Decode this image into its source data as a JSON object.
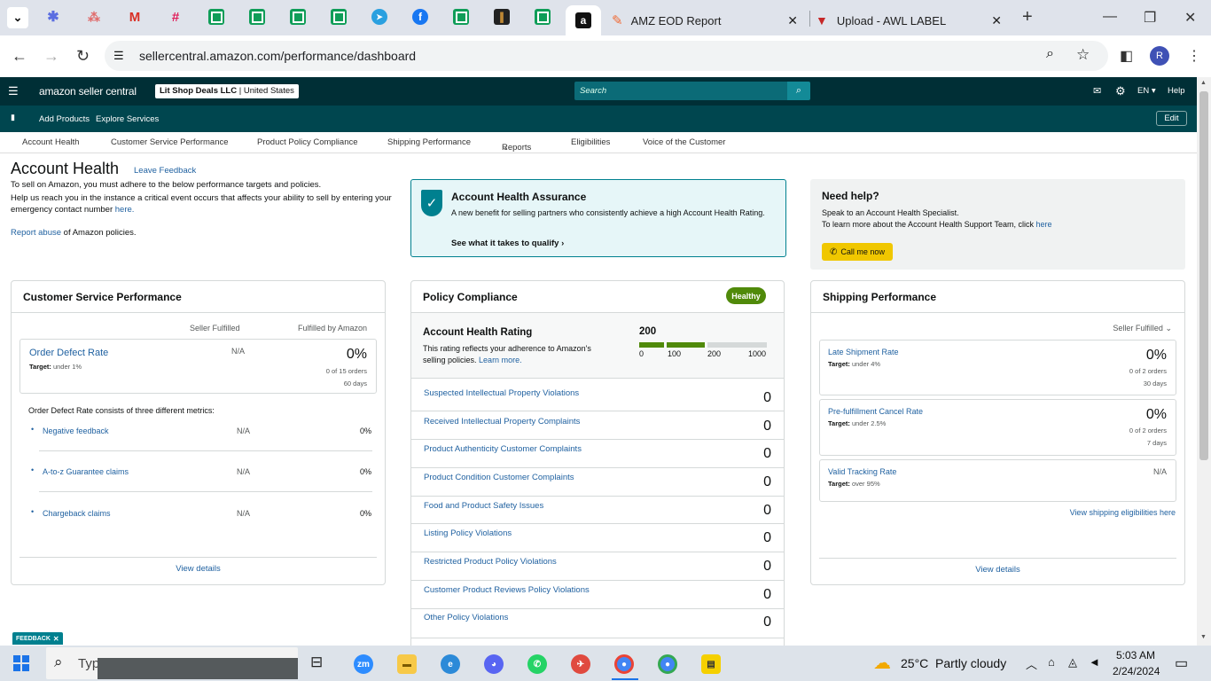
{
  "browser": {
    "active_tab_icon": "a",
    "tabs": [
      {
        "title": "AMZ EOD Report"
      },
      {
        "title": "Upload - AWL LABEL"
      }
    ],
    "url": "sellercentral.amazon.com/performance/dashboard",
    "profile_initial": "R"
  },
  "header": {
    "logo": "amazon seller central",
    "store_name": "Lit Shop Deals LLC",
    "store_region": "United States",
    "search_placeholder": "Search",
    "language": "EN",
    "help": "Help"
  },
  "subnav": {
    "items": [
      "Add Products",
      "Explore Services"
    ],
    "edit": "Edit"
  },
  "topnav": {
    "items": [
      "Account Health",
      "Customer Service Performance",
      "Product Policy Compliance",
      "Shipping Performance",
      "Reports",
      "Eligibilities",
      "Voice of the Customer"
    ]
  },
  "page": {
    "title": "Account Health",
    "leave_feedback": "Leave Feedback",
    "intro1": "To sell on Amazon, you must adhere to the below performance targets and policies.",
    "intro2a": "Help us reach you in the instance a critical event occurs that affects your ability to sell by entering your emergency contact number ",
    "intro2_link": "here.",
    "report_link": "Report abuse",
    "report_rest": " of Amazon policies."
  },
  "assurance": {
    "title": "Account Health Assurance",
    "body": "A new benefit for selling partners who consistently achieve a high Account Health Rating.",
    "link": "See what it takes to qualify"
  },
  "help_box": {
    "title": "Need help?",
    "line1": "Speak to an Account Health Specialist.",
    "line2": "To learn more about the Account Health Support Team, click ",
    "line2_link": "here",
    "button": "Call me now"
  },
  "csp": {
    "title": "Customer Service Performance",
    "col1": "Seller Fulfilled",
    "col2": "Fulfilled by Amazon",
    "odr_label": "Order Defect Rate",
    "odr_target_label": "Target:",
    "odr_target": "under 1%",
    "odr_seller": "N/A",
    "odr_fba": "0%",
    "odr_orders": "0 of 15 orders",
    "odr_days": "60 days",
    "metrics_intro": "Order Defect Rate consists of three different metrics:",
    "metrics": [
      {
        "name": "Negative feedback",
        "seller": "N/A",
        "fba": "0%"
      },
      {
        "name": "A-to-z Guarantee claims",
        "seller": "N/A",
        "fba": "0%"
      },
      {
        "name": "Chargeback claims",
        "seller": "N/A",
        "fba": "0%"
      }
    ],
    "view_details": "View details"
  },
  "policy": {
    "title": "Policy Compliance",
    "badge": "Healthy",
    "ahr_title": "Account Health Rating",
    "ahr_desc": "This rating reflects your adherence to Amazon's selling policies.",
    "ahr_learn": "Learn more.",
    "ahr_value": "200",
    "scale": [
      "0",
      "100",
      "200",
      "1000"
    ],
    "rows": [
      {
        "label": "Suspected Intellectual Property Violations",
        "value": "0"
      },
      {
        "label": "Received Intellectual Property Complaints",
        "value": "0"
      },
      {
        "label": "Product Authenticity Customer Complaints",
        "value": "0"
      },
      {
        "label": "Product Condition Customer Complaints",
        "value": "0"
      },
      {
        "label": "Food and Product Safety Issues",
        "value": "0"
      },
      {
        "label": "Listing Policy Violations",
        "value": "0"
      },
      {
        "label": "Restricted Product Policy Violations",
        "value": "0"
      },
      {
        "label": "Customer Product Reviews Policy Violations",
        "value": "0"
      },
      {
        "label": "Other Policy Violations",
        "value": "0"
      }
    ]
  },
  "shipping": {
    "title": "Shipping Performance",
    "filter": "Seller Fulfilled",
    "metrics": [
      {
        "name": "Late Shipment Rate",
        "target_label": "Target:",
        "target": "under 4%",
        "value": "0%",
        "orders": "0 of 2 orders",
        "days": "30 days"
      },
      {
        "name": "Pre-fulfillment Cancel Rate",
        "target_label": "Target:",
        "target": "under 2.5%",
        "value": "0%",
        "orders": "0 of 2 orders",
        "days": "7 days"
      },
      {
        "name": "Valid Tracking Rate",
        "target_label": "Target:",
        "target": "over 95%",
        "value": "N/A"
      }
    ],
    "eligibility_link": "View shipping eligibilities here",
    "view_details": "View details"
  },
  "feedback_tab": "FEEDBACK",
  "taskbar": {
    "search_text": "Typ",
    "weather": "25°C  Partly cloudy",
    "time": "5:03 AM",
    "date": "2/24/2024"
  },
  "colors": {
    "header": "#002f36",
    "subheader": "#00464f",
    "healthy": "#508a0a",
    "call_button": "#f0c700",
    "link": "#2162a1"
  }
}
